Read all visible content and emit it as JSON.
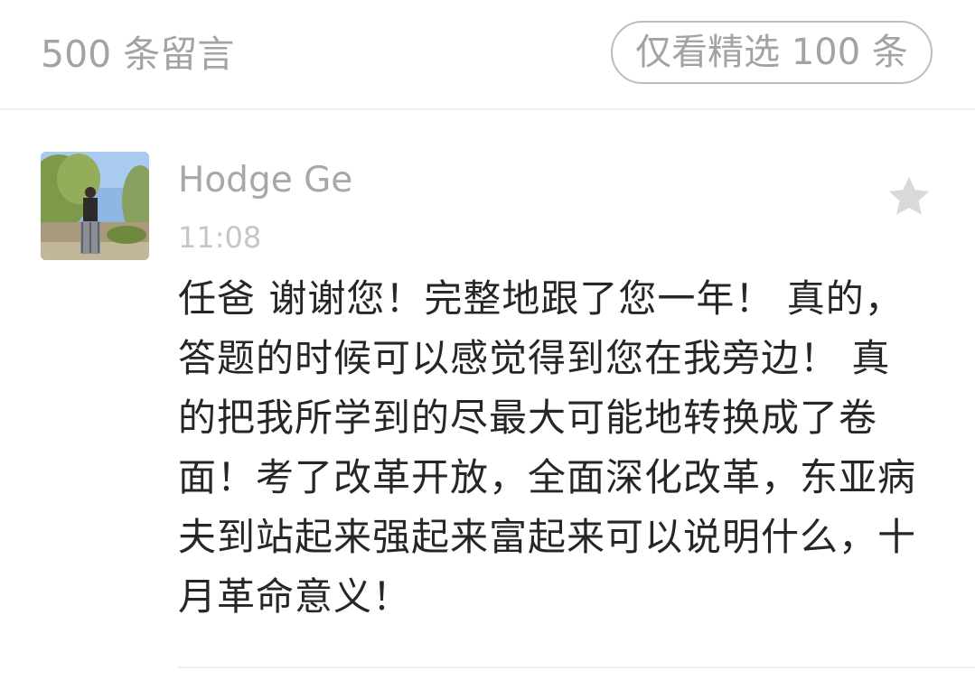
{
  "header": {
    "comment_count": "500 条留言",
    "filter_label": "仅看精选 100 条"
  },
  "comment": {
    "author": "Hodge Ge",
    "time": "11:08",
    "text": "任爸 谢谢您！完整地跟了您一年！ 真的，答题的时候可以感觉得到您在我旁边！ 真的把我所学到的尽最大可能地转换成了卷面！考了改革开放，全面深化改革，东亚病夫到站起来强起来富起来可以说明什么，十月革命意义！",
    "avatar_icon": "avatar-photo-icon",
    "star_icon": "star-icon"
  },
  "colors": {
    "muted_text": "#a3a3a3",
    "time_text": "#c6c6c6",
    "body_text": "#262626",
    "star": "#d9d9d9",
    "divider": "#ededed"
  }
}
